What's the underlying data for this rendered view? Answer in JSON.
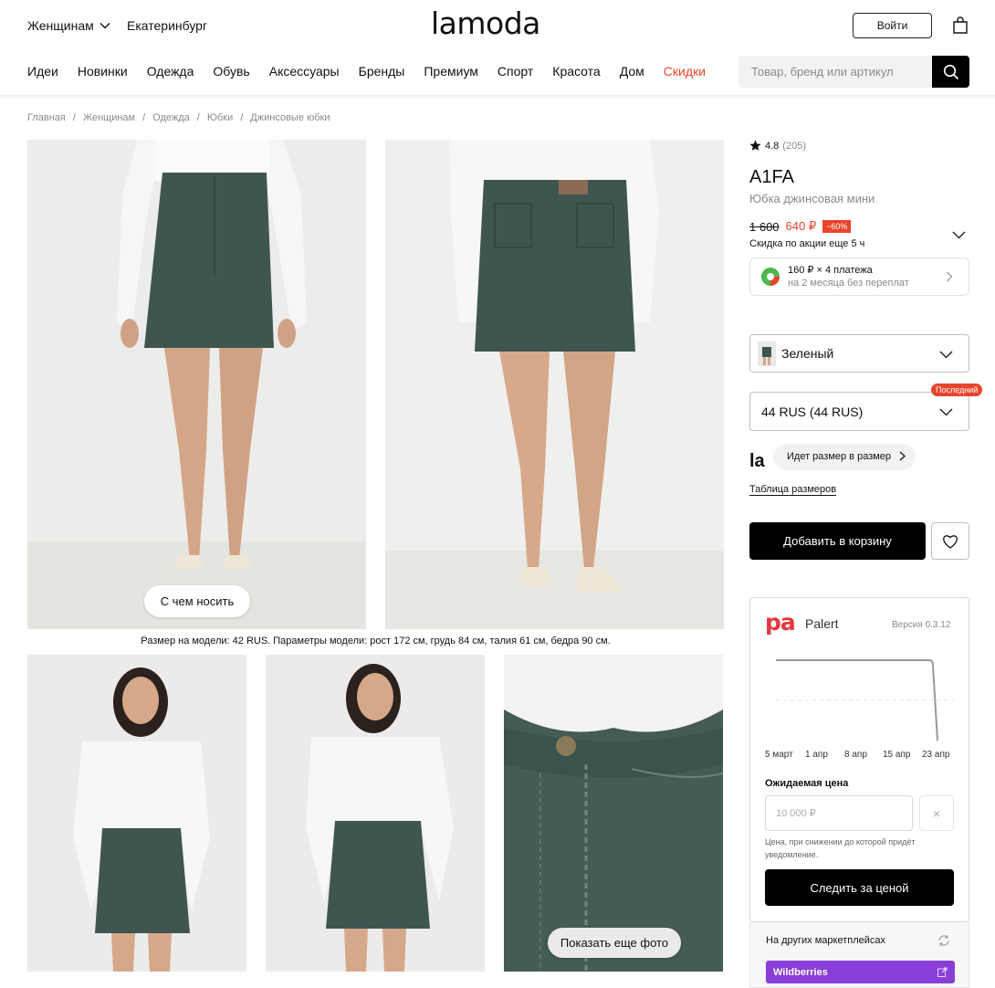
{
  "header": {
    "gender_menu": "Женщинам",
    "city": "Екатеринбург",
    "logo": "lamoda",
    "login": "Войти",
    "nav": [
      "Идеи",
      "Новинки",
      "Одежда",
      "Обувь",
      "Аксессуары",
      "Бренды",
      "Премиум",
      "Спорт",
      "Красота",
      "Дом",
      "Скидки"
    ],
    "search_placeholder": "Товар, бренд или артикул"
  },
  "breadcrumbs": [
    "Главная",
    "Женщинам",
    "Одежда",
    "Юбки",
    "Джинсовые юбки"
  ],
  "gallery": {
    "what_to_wear": "С чем носить",
    "model_info": "Размер на модели: 42 RUS. Параметры модели: рост 172 см, грудь 84 см, талия 61 см, бедра 90 см.",
    "show_more": "Показать еще фото"
  },
  "product": {
    "rating": "4.8",
    "reviews": "(205)",
    "brand": "A1FA",
    "name": "Юбка джинсовая мини",
    "old_price": "1 600",
    "price": "640 ₽",
    "discount": "−60%",
    "promo_timer": "Скидка по акции еще 5 ч",
    "installment_main": "160 ₽ × 4 платежа",
    "installment_sub": "на 2 месяца без переплат",
    "color": "Зеленый",
    "size": "44 RUS (44 RUS)",
    "last_badge": "Последний",
    "size_finder_logo": "la",
    "size_finder": "Идет размер в размер",
    "size_table": "Таблица размеров",
    "add_to_cart": "Добавить в корзину"
  },
  "palert": {
    "logo_mark": "pa",
    "name": "Palert",
    "version": "Версия 0.3.12",
    "chart_ticks": [
      "5 март",
      "1 апр",
      "8 апр",
      "15 апр",
      "23 апр"
    ],
    "expected_label": "Ожидаемая цена",
    "expected_placeholder": "10 000 ₽",
    "clear": "×",
    "hint": "Цена, при снижении до которой придёт уведомление.",
    "track_button": "Следить за ценой",
    "other_markets": "На других маркетплейсах",
    "wildberries": "Wildberries"
  },
  "colors": {
    "sale": "#e8442b",
    "palert_brand": "#e2383f",
    "wildberries": "#8a3ed8",
    "skirt": "#3f5650"
  }
}
